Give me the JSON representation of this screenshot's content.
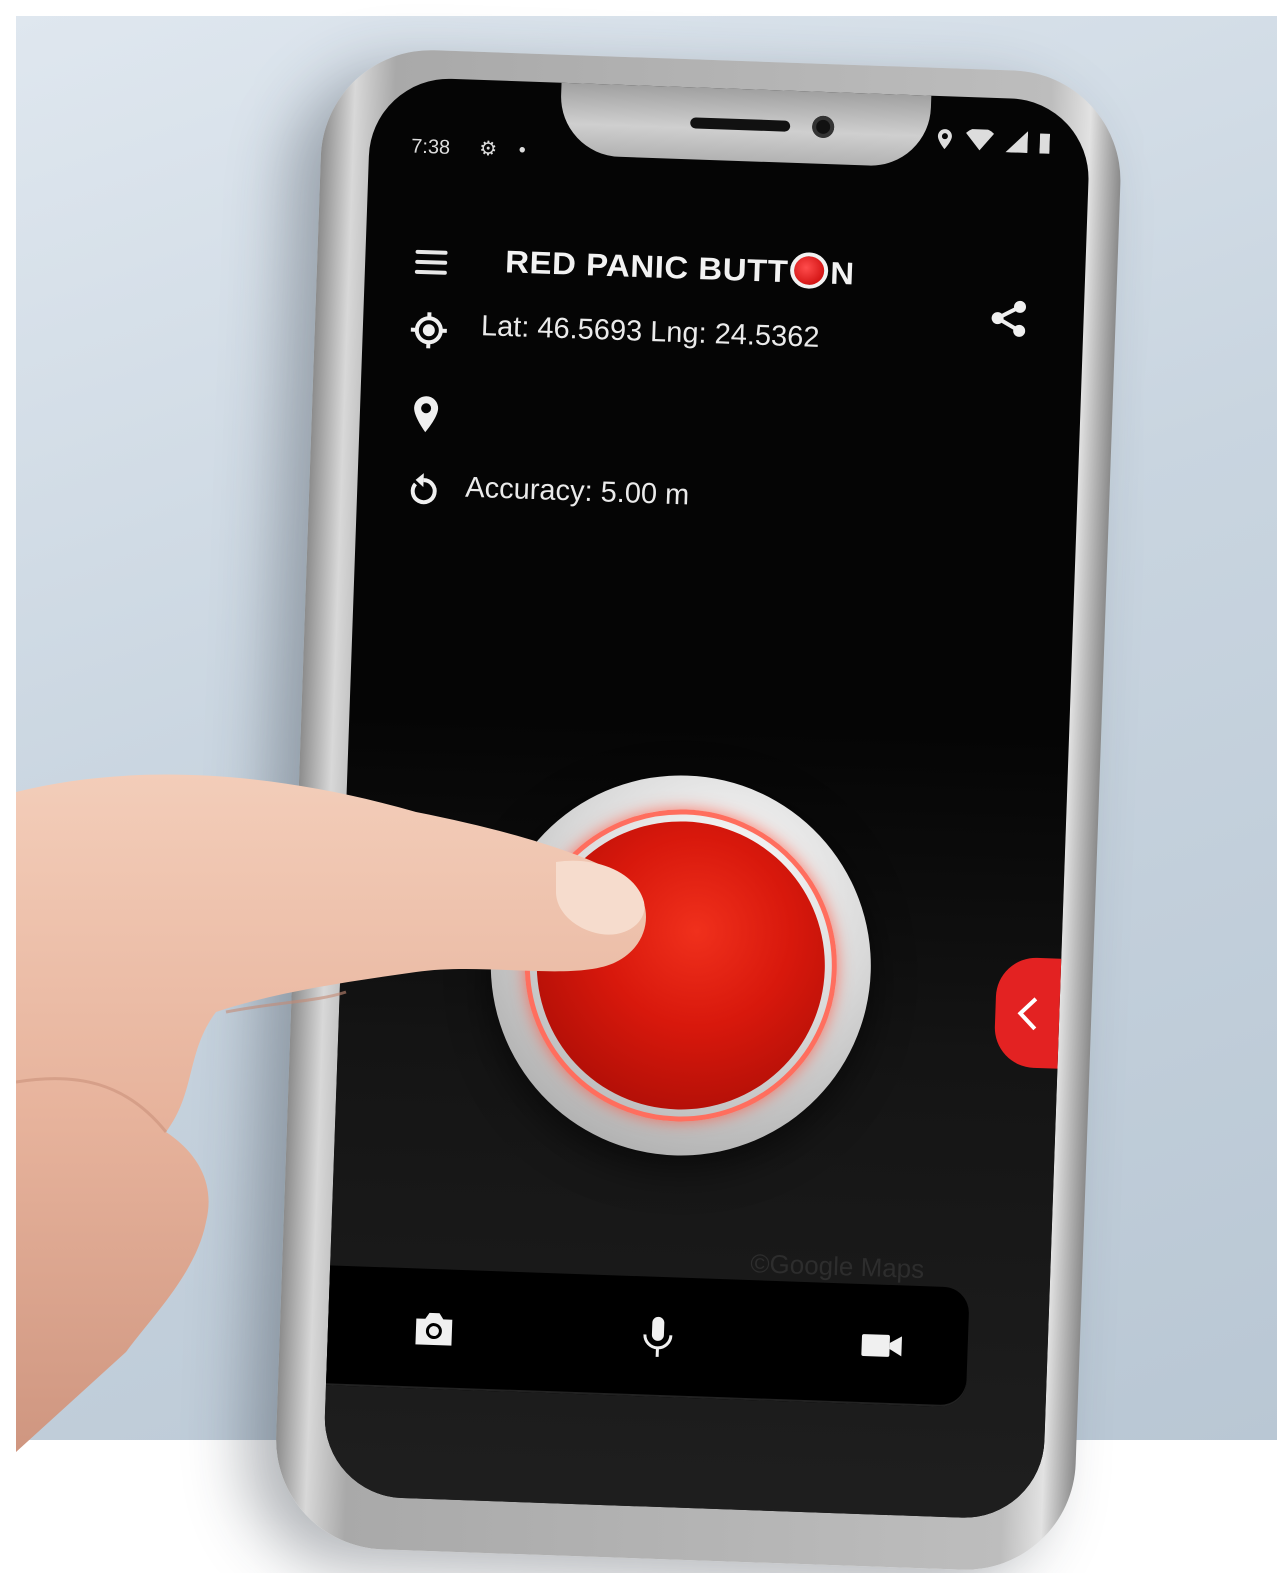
{
  "status_bar": {
    "time": "7:38"
  },
  "app": {
    "title_part1": "RED PANIC BUTT",
    "title_part2": "N"
  },
  "location": {
    "coords": "Lat: 46.5693 Lng: 24.5362",
    "accuracy": "Accuracy: 5.00 m"
  },
  "icons": {
    "menu": "menu-icon",
    "share": "share-icon",
    "gps": "gps-target-icon",
    "pin": "location-pin-icon",
    "refresh": "refresh-icon",
    "side_tab": "chevron-left-icon",
    "camera": "camera-icon",
    "microphone": "microphone-icon",
    "video": "video-camera-icon"
  },
  "colors": {
    "accent_red": "#e32222",
    "screen_bg": "#050505",
    "text": "#eaeaea"
  },
  "map_credit": "©Google Maps"
}
